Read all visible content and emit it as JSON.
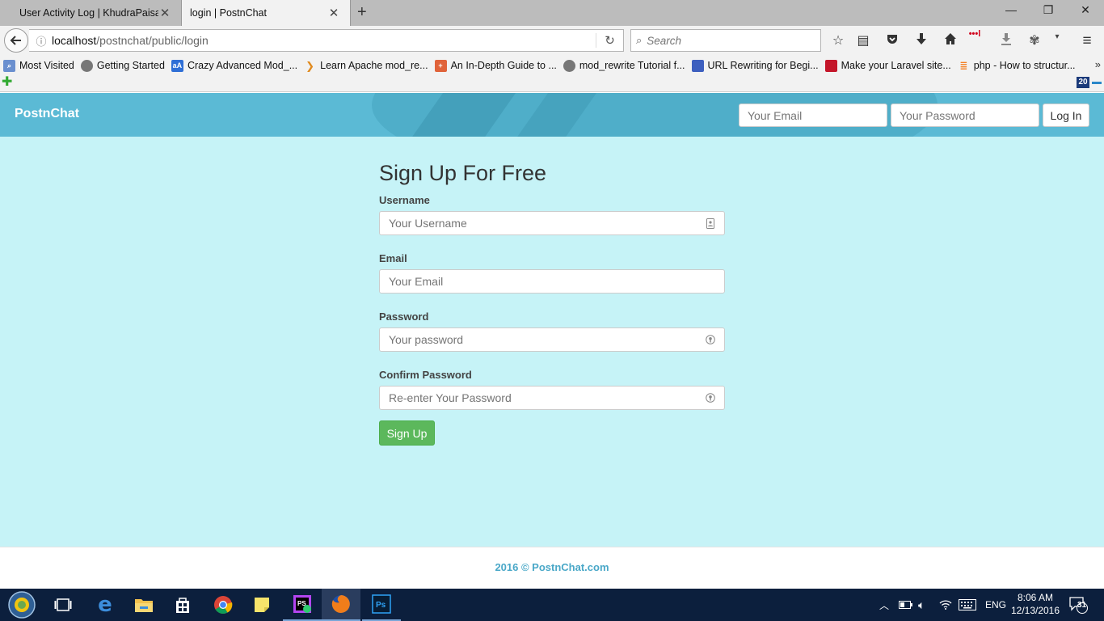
{
  "browser": {
    "tabs": [
      {
        "title": "User Activity Log | KhudraPaisa",
        "active": false
      },
      {
        "title": "login | PostnChat",
        "active": true
      }
    ],
    "url_host": "localhost",
    "url_path": "/postnchat/public/login",
    "search_placeholder": "Search",
    "bookmarks": [
      {
        "label": "Most Visited",
        "icon": "most-visited-icon",
        "color": "#6a8fcf"
      },
      {
        "label": "Getting Started",
        "icon": "globe-icon",
        "color": "#777777"
      },
      {
        "label": "Crazy Advanced Mod_...",
        "icon": "aa-icon",
        "color": "#2f6fd6"
      },
      {
        "label": "Learn Apache mod_re...",
        "icon": "sitepoint-icon",
        "color": "#e08a1e"
      },
      {
        "label": "An In-Depth Guide to ...",
        "icon": "plus-box-icon",
        "color": "#e0633a"
      },
      {
        "label": "mod_rewrite Tutorial f...",
        "icon": "globe-icon",
        "color": "#777777"
      },
      {
        "label": "URL Rewriting for Begi...",
        "icon": "blue-square-icon",
        "color": "#3d5fbf"
      },
      {
        "label": "Make your Laravel site...",
        "icon": "cube-icon",
        "color": "#c4162a"
      },
      {
        "label": "php - How to structur...",
        "icon": "stackoverflow-icon",
        "color": "#f48024"
      }
    ],
    "addon_badge": "20"
  },
  "header": {
    "brand": "PostnChat",
    "email_placeholder": "Your Email",
    "password_placeholder": "Your Password",
    "login_label": "Log In",
    "colors": {
      "header_bg": "#5bbad5"
    }
  },
  "signup": {
    "title": "Sign Up For Free",
    "username_label": "Username",
    "username_placeholder": "Your Username",
    "email_label": "Email",
    "email_placeholder": "Your Email",
    "password_label": "Password",
    "password_placeholder": "Your password",
    "confirm_label": "Confirm Password",
    "confirm_placeholder": "Re-enter Your Password",
    "submit_label": "Sign Up",
    "colors": {
      "page_bg": "#c6f3f7",
      "button": "#5cb85c"
    }
  },
  "footer": {
    "text": "2016 © PostnChat.com"
  },
  "taskbar": {
    "time": "8:06 AM",
    "date": "12/13/2016",
    "language": "ENG",
    "notifications": "31"
  }
}
